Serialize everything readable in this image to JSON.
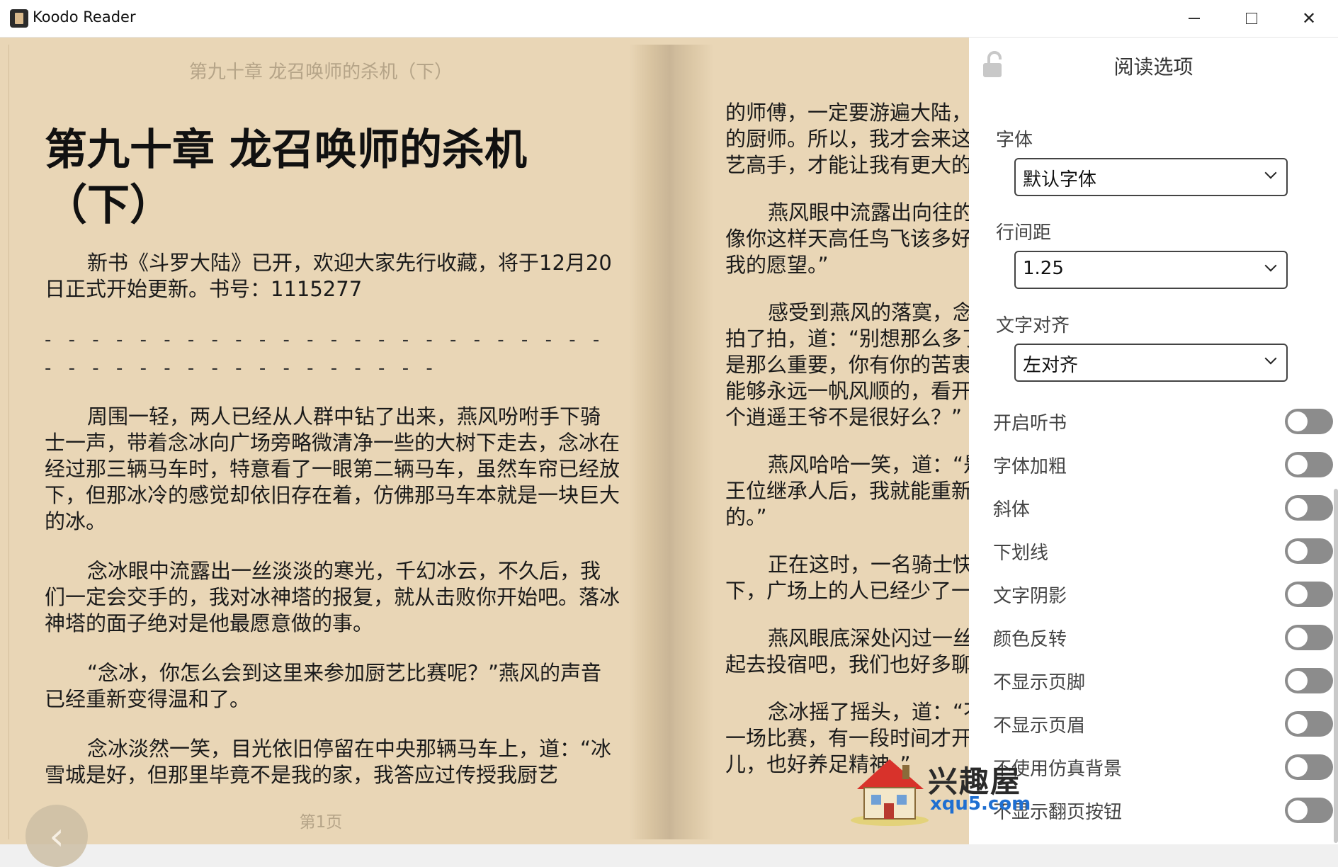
{
  "window": {
    "app_title": "Koodo Reader",
    "minimize_icon": "minimize-icon",
    "maximize_icon": "maximize-icon",
    "close_icon": "close-icon",
    "close_glyph": "✕"
  },
  "reader": {
    "running_header": "第九十章 龙召唤师的杀机（下）",
    "right_header_fragment": "》",
    "chapter_title": "第九十章 龙召唤师的杀机（下）",
    "page_number": "第1页",
    "prev_glyph": "‹",
    "left_paragraphs": [
      "新书《斗罗大陆》已开，欢迎大家先行收藏，将于12月20日正式开始更新。书号：1115277",
      "周围一轻，两人已经从人群中钻了出来，燕风吩咐手下骑士一声，带着念冰向广场旁略微清净一些的大树下走去，念冰在经过那三辆马车时，特意看了一眼第二辆马车，虽然车帘已经放下，但那冰冷的感觉却依旧存在着，仿佛那马车本就是一块巨大的冰。",
      "念冰眼中流露出一丝淡淡的寒光，千幻冰云，不久后，我们一定会交手的，我对冰神塔的报复，就从击败你开始吧。落冰神塔的面子绝对是他最愿意做的事。",
      "“念冰，你怎么会到这里来参加厨艺比赛呢？”燕风的声音已经重新变得温和了。",
      "念冰淡然一笑，目光依旧停留在中央那辆马车上，道：“冰雪城是好，但那里毕竟不是我的家，我答应过传授我厨艺"
    ],
    "dash_line": "- - - - - - - - - - - - - - - - - - - - - - - - - - - - - - - - - - - - - - - - -",
    "right_lines": [
      {
        "text": "的师傅，一定要游遍大陆，",
        "indent": false
      },
      {
        "text": "的厨师。所以，我才会来这",
        "indent": false
      },
      {
        "text": "艺高手，才能让我有更大的",
        "indent": false
      },
      {
        "text": "燕风眼中流露出向往的",
        "indent": true
      },
      {
        "text": "像你这样天高任鸟飞该多好",
        "indent": false
      },
      {
        "text": "我的愿望。”",
        "indent": false
      },
      {
        "text": "感受到燕风的落寞，念",
        "indent": true
      },
      {
        "text": "拍了拍，道：“别想那么多了",
        "indent": false
      },
      {
        "text": "是那么重要，你有你的苦衷",
        "indent": false
      },
      {
        "text": "能够永远一帆风顺的，看开",
        "indent": false
      },
      {
        "text": "个逍遥王爷不是很好么？”",
        "indent": false
      },
      {
        "text": "燕风哈哈一笑，道：“是",
        "indent": true
      },
      {
        "text": "王位继承人后，我就能重新",
        "indent": false
      },
      {
        "text": "的。”",
        "indent": false
      },
      {
        "text": "正在这时，一名骑士快",
        "indent": true
      },
      {
        "text": "下，广场上的人已经少了一",
        "indent": false
      },
      {
        "text": "燕风眼底深处闪过一丝",
        "indent": true
      },
      {
        "text": "起去投宿吧，我们也好多聊",
        "indent": false
      },
      {
        "text": "念冰摇了摇头，道：“不",
        "indent": true
      },
      {
        "text": "一场比赛，有一段时间才开",
        "indent": false
      },
      {
        "text": "儿，也好养足精神。”",
        "indent": false
      }
    ]
  },
  "settings": {
    "title": "阅读选项",
    "lock_icon": "unlock-icon",
    "font_label": "字体",
    "font_value": "默认字体",
    "line_height_label": "行间距",
    "line_height_value": "1.25",
    "align_label": "文字对齐",
    "align_value": "左对齐",
    "toggles": [
      {
        "label": "开启听书",
        "on": false
      },
      {
        "label": "字体加粗",
        "on": false
      },
      {
        "label": "斜体",
        "on": false
      },
      {
        "label": "下划线",
        "on": false
      },
      {
        "label": "文字阴影",
        "on": false
      },
      {
        "label": "颜色反转",
        "on": false
      },
      {
        "label": "不显示页脚",
        "on": false
      },
      {
        "label": "不显示页眉",
        "on": false
      },
      {
        "label": "不使用仿真背景",
        "on": false
      },
      {
        "label": "不显示翻页按钮",
        "on": false
      }
    ]
  },
  "watermark": {
    "name": "兴趣屋",
    "url": "xqu5.com"
  },
  "colors": {
    "page_bg": "#e9d6b6",
    "toggle_off": "#8c8c8c",
    "panel_bg": "#ffffff"
  }
}
